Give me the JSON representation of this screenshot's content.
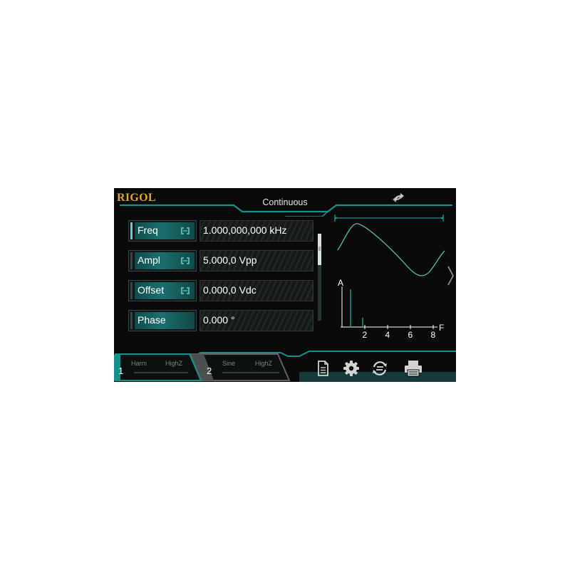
{
  "header": {
    "logo": "RIGOL",
    "mode": "Continuous",
    "sync_icon": "sync-arrows-icon"
  },
  "params": [
    {
      "label": "Freq",
      "value": "1.000,000,000 kHz",
      "coupling": true
    },
    {
      "label": "Ampl",
      "value": "5.000,0 Vpp",
      "coupling": true
    },
    {
      "label": "Offset",
      "value": "0.000,0 Vdc",
      "coupling": true
    },
    {
      "label": "Phase",
      "value": "0.000 °",
      "coupling": false
    }
  ],
  "spectrum": {
    "y_label": "A",
    "x_label": "F",
    "ticks": [
      "2",
      "4",
      "6",
      "8"
    ],
    "harmonic_levels": [
      1.0,
      0.25
    ]
  },
  "channels": [
    {
      "number": "1",
      "waveform": "Harm",
      "load": "HighZ",
      "active": true
    },
    {
      "number": "2",
      "waveform": "Sine",
      "load": "HighZ",
      "active": false
    }
  ],
  "toolbar": [
    "document-icon",
    "gear-icon",
    "sync-circle-icon",
    "printer-icon"
  ],
  "colors": {
    "accent": "#1a8f8a",
    "logo": "#e0a33a",
    "background": "#0b0a0a"
  }
}
